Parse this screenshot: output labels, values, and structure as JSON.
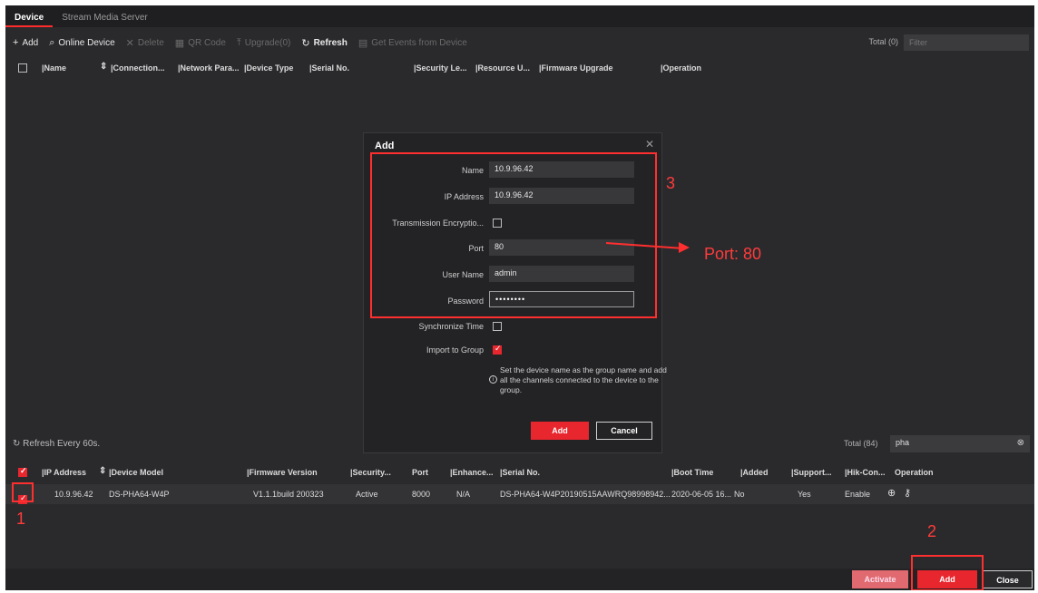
{
  "tabs": [
    {
      "label": "Device"
    },
    {
      "label": "Stream Media Server"
    }
  ],
  "toolbar": {
    "add": "Add",
    "online_device": "Online Device",
    "delete": "Delete",
    "qr_code": "QR Code",
    "upgrade": "Upgrade(0)",
    "refresh": "Refresh",
    "get_events": "Get Events from Device",
    "total": "Total (0)",
    "filter_placeholder": "Filter"
  },
  "device_table": {
    "columns": [
      "Name",
      "Connection...",
      "Network Para...",
      "Device Type",
      "Serial No.",
      "Security Le...",
      "Resource U...",
      "Firmware Upgrade",
      "Operation"
    ]
  },
  "dialog": {
    "title": "Add",
    "fields": {
      "name_label": "Name",
      "name_value": "10.9.96.42",
      "ip_label": "IP Address",
      "ip_value": "10.9.96.42",
      "encryption_label": "Transmission Encryptio...",
      "port_label": "Port",
      "port_value": "80",
      "user_label": "User Name",
      "user_value": "admin",
      "password_label": "Password",
      "password_value": "••••••••",
      "sync_label": "Synchronize Time",
      "import_label": "Import to Group"
    },
    "note": "Set the device name as the group name and add all the channels connected to the device to the group.",
    "add_button": "Add",
    "cancel_button": "Cancel"
  },
  "online": {
    "refresh_label": "Refresh Every 60s.",
    "total": "Total (84)",
    "search_value": "pha",
    "columns": [
      "IP Address",
      "Device Model",
      "Firmware Version",
      "Security...",
      "Port",
      "Enhance...",
      "Serial No.",
      "Boot Time",
      "Added",
      "Support...",
      "Hik-Con...",
      "Operation"
    ],
    "rows": [
      {
        "ip": "10.9.96.42",
        "model": "DS-PHA64-W4P",
        "firmware": "V1.1.1build 200323",
        "security": "Active",
        "port": "8000",
        "enhance": "N/A",
        "serial": "DS-PHA64-W4P20190515AAWRQ98998942...",
        "boot": "2020-06-05 16...",
        "added": "No",
        "support": "Yes",
        "hik": "Enable"
      }
    ]
  },
  "footer": {
    "activate": "Activate",
    "add": "Add",
    "close": "Close"
  },
  "annotations": {
    "n1": "1",
    "n2": "2",
    "n3": "3",
    "port_note": "Port: 80"
  }
}
